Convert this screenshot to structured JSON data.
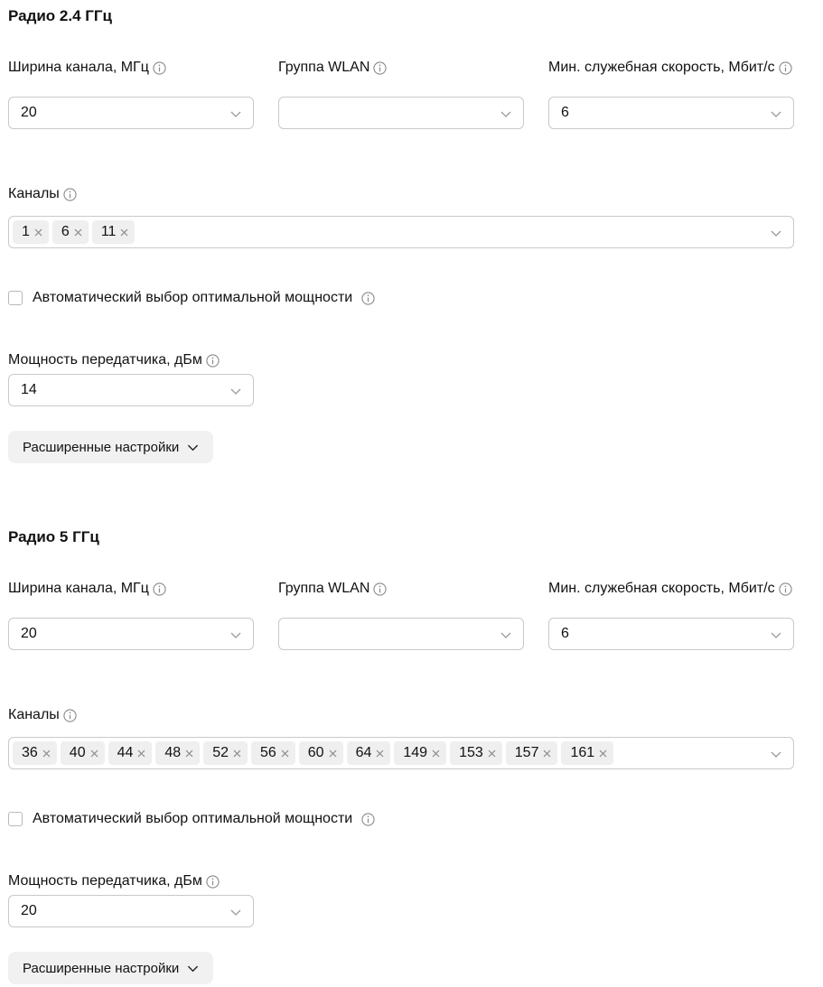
{
  "sections": [
    {
      "title": "Радио 2.4 ГГц",
      "channel_width": {
        "label": "Ширина канала, МГц",
        "value": "20"
      },
      "wlan_group": {
        "label": "Группа WLAN",
        "value": ""
      },
      "min_rate": {
        "label": "Мин. служебная скорость, Мбит/с",
        "value": "6"
      },
      "channels": {
        "label": "Каналы",
        "chips": [
          "1",
          "6",
          "11"
        ]
      },
      "auto_power": {
        "label": "Автоматический выбор оптимальной мощности",
        "checked": false
      },
      "tx_power": {
        "label": "Мощность передатчика, дБм",
        "value": "14"
      },
      "advanced_label": "Расширенные настройки"
    },
    {
      "title": "Радио 5 ГГц",
      "channel_width": {
        "label": "Ширина канала, МГц",
        "value": "20"
      },
      "wlan_group": {
        "label": "Группа WLAN",
        "value": ""
      },
      "min_rate": {
        "label": "Мин. служебная скорость, Мбит/с",
        "value": "6"
      },
      "channels": {
        "label": "Каналы",
        "chips": [
          "36",
          "40",
          "44",
          "48",
          "52",
          "56",
          "60",
          "64",
          "149",
          "153",
          "157",
          "161"
        ]
      },
      "auto_power": {
        "label": "Автоматический выбор оптимальной мощности",
        "checked": false
      },
      "tx_power": {
        "label": "Мощность передатчика, дБм",
        "value": "20"
      },
      "advanced_label": "Расширенные настройки"
    }
  ],
  "icons": {
    "info": "info-icon",
    "chevron": "chevron-down-icon",
    "remove": "close-icon"
  },
  "colors": {
    "border": "#c9c9c9",
    "chip_bg": "#efefef",
    "button_bg": "#f1f1f1",
    "icon": "#8a8a8a",
    "text": "#111111"
  }
}
